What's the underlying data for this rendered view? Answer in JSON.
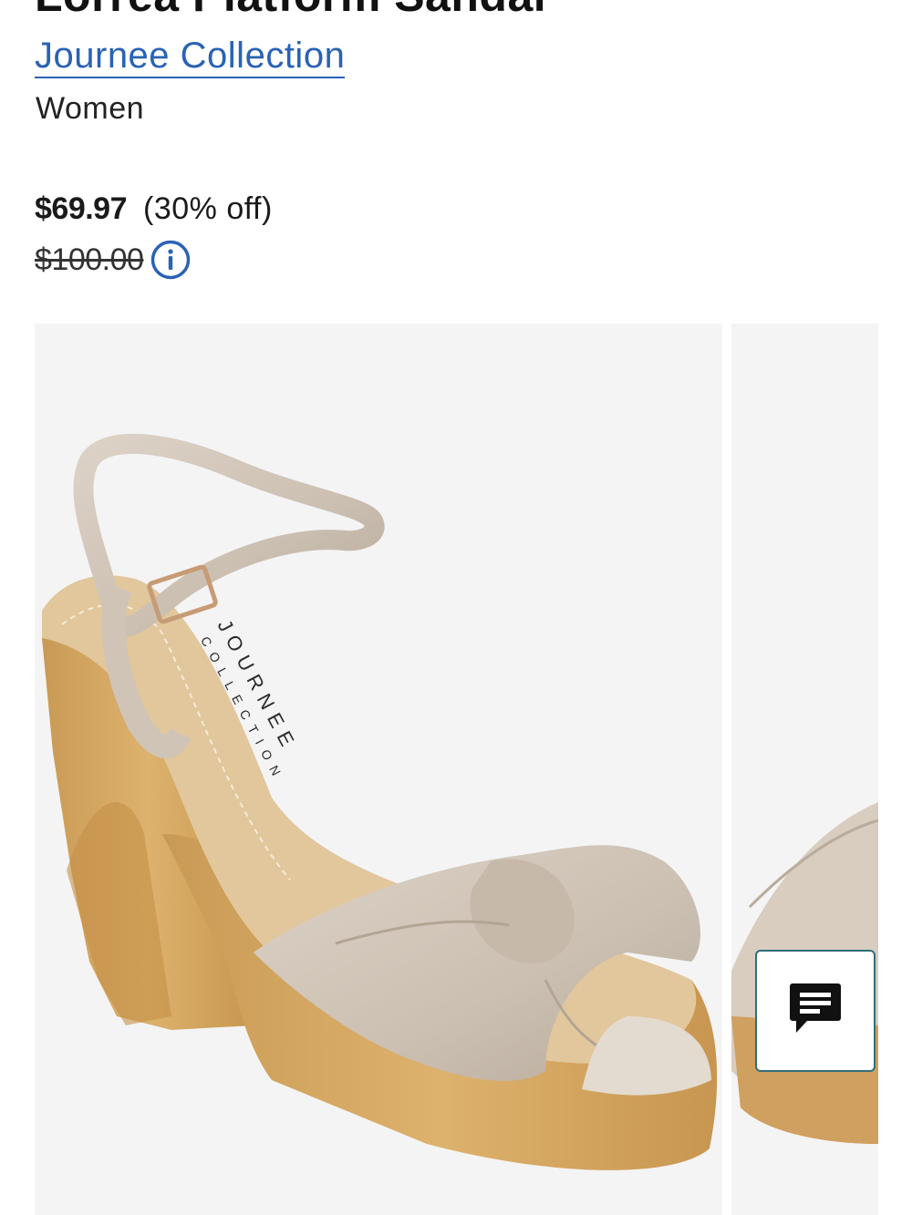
{
  "product": {
    "title": "Lorrea Platform Sandal",
    "brand": "Journee Collection",
    "department": "Women"
  },
  "pricing": {
    "sale_price": "$69.97",
    "discount": "(30% off)",
    "original_price": "$100.00"
  },
  "product_image": {
    "logo_line1": "JOURNEE",
    "logo_line2": "COLLECTION"
  },
  "colors": {
    "brand_link": "#2a62b5",
    "chat_border": "#2f6e7a",
    "image_background": "#f4f4f5"
  },
  "icons": {
    "info": "info-circle-icon",
    "chat": "chat-bubble-icon"
  }
}
